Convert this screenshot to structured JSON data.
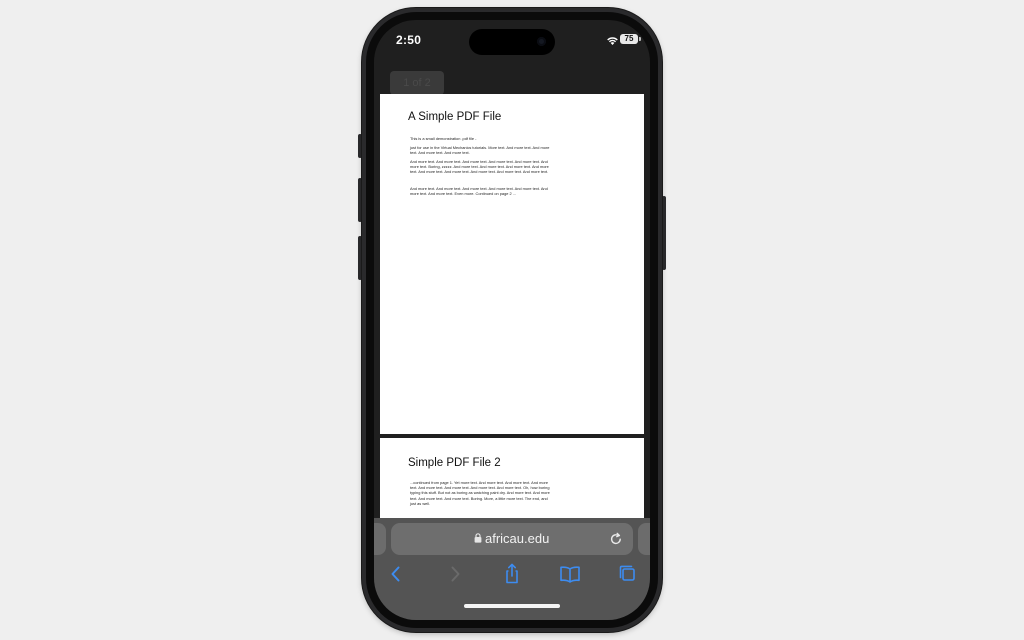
{
  "status_bar": {
    "time": "2:50",
    "battery": "75"
  },
  "pdf": {
    "page_indicator": "1 of 2",
    "pages": [
      {
        "title": "A Simple PDF File",
        "paragraphs": [
          "This is a small demonstration .pdf file -",
          "just for use in the Virtual Mechanics tutorials. More text. And more text. And more text. And more text. And more text.",
          "And more text. And more text. And more text. And more text. And more text. And more text. Boring, zzzzz. And more text. And more text. And more text. And more text. And more text. And more text. And more text. And more text. And more text.",
          "And more text. And more text. And more text. And more text. And more text. And more text. And more text. Even more. Continued on page 2 ..."
        ]
      },
      {
        "title": "Simple PDF File 2",
        "paragraphs": [
          "...continued from page 1. Yet more text. And more text. And more text. And more text. And more text. And more text. And more text. And more text. Oh, how boring typing this stuff. But not as boring as watching paint dry. And more text. And more text. And more text. And more text. Boring. More, a little more text. The end, and just as well."
        ]
      }
    ]
  },
  "toolbar": {
    "url": "africau.edu"
  },
  "icons": {
    "lock": "lock-icon",
    "reload": "reload-icon",
    "back": "chevron-left-icon",
    "forward": "chevron-right-icon",
    "share": "share-icon",
    "bookmarks": "book-icon",
    "tabs": "tabs-icon",
    "wifi": "wifi-icon"
  },
  "colors": {
    "accent": "#3d8cf0",
    "toolbar_bg": "#545454",
    "address_bg": "#6e6e6e"
  }
}
